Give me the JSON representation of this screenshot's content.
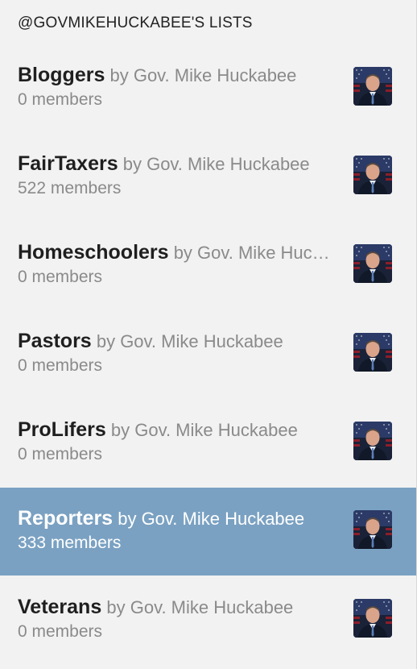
{
  "header": {
    "title": "@GOVMIKEHUCKABEE'S LISTS"
  },
  "lists": [
    {
      "name": "Bloggers",
      "by": "by Gov. Mike Huckabee",
      "members": "0 members",
      "selected": false
    },
    {
      "name": "FairTaxers",
      "by": "by Gov. Mike Huckabee",
      "members": "522 members",
      "selected": false
    },
    {
      "name": "Homeschoolers",
      "by": "by Gov. Mike Huckabee",
      "members": "0 members",
      "selected": false
    },
    {
      "name": "Pastors",
      "by": "by Gov. Mike Huckabee",
      "members": "0 members",
      "selected": false
    },
    {
      "name": "ProLifers",
      "by": "by Gov. Mike Huckabee",
      "members": "0 members",
      "selected": false
    },
    {
      "name": "Reporters",
      "by": "by Gov. Mike Huckabee",
      "members": "333 members",
      "selected": true
    },
    {
      "name": "Veterans",
      "by": "by Gov. Mike Huckabee",
      "members": "0 members",
      "selected": false
    }
  ],
  "colors": {
    "background": "#f2f2f2",
    "selected_background": "#7aa1c2",
    "name_text": "#1f1f1f",
    "secondary_text": "#8a8a8a"
  },
  "icons": {
    "avatar": "user-avatar-photo"
  }
}
